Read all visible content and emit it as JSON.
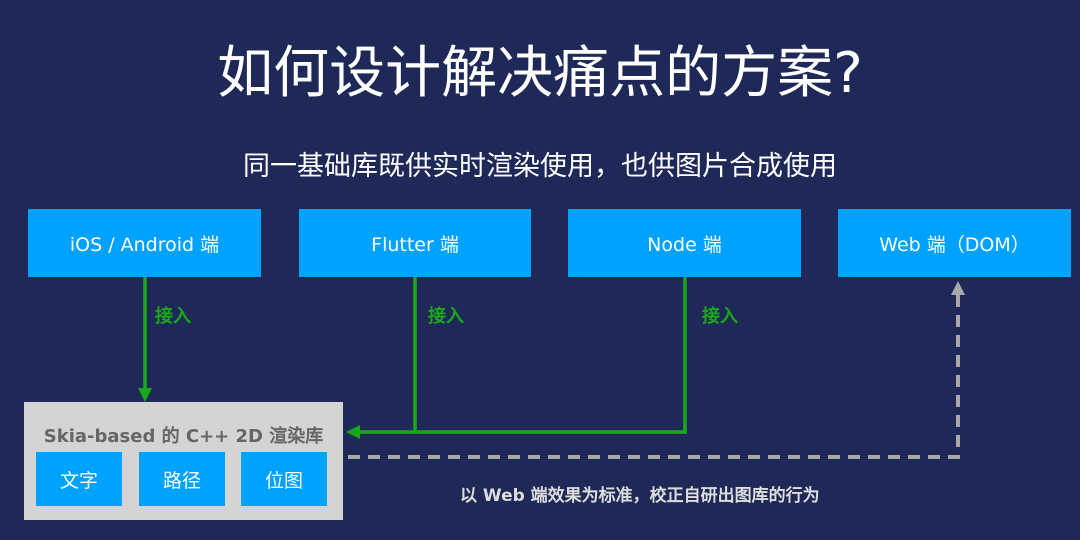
{
  "title": "如何设计解决痛点的方案?",
  "subtitle": "同一基础库既供实时渲染使用，也供图片合成使用",
  "clients": [
    {
      "label": "iOS / Android 端"
    },
    {
      "label": "Flutter 端"
    },
    {
      "label": "Node 端"
    },
    {
      "label": "Web 端（DOM）"
    }
  ],
  "connection_label": "接入",
  "library": {
    "title": "Skia-based 的 C++ 2D 渲染库",
    "modules": [
      "文字",
      "路径",
      "位图"
    ]
  },
  "caption": "以 Web 端效果为标准，校正自研出图库的行为",
  "colors": {
    "background": "#1e2957",
    "box": "#00a2ff",
    "connector": "#1aa81a",
    "dashed": "#a8a8a8",
    "library": "#d4d4d4"
  }
}
